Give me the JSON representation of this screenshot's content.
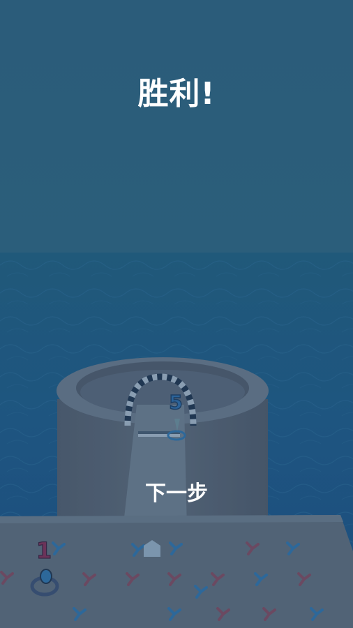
{
  "screen": {
    "title": "胜利!",
    "next_button_label": "下一步"
  },
  "scene": {
    "finish_gate_number": "5",
    "level_board_number": "1"
  },
  "colors": {
    "sky": "#2c6180",
    "sea": "#1d5888",
    "tower": "#57657a",
    "board": "#5b6a7c",
    "blue_figure": "#2f6fa8",
    "red_figure": "#7a4a62",
    "gate_dark": "#1f3450",
    "gate_light": "#9fb0c4",
    "level_number": "#7a2f58"
  },
  "icons": [
    "finish-gate-icon",
    "ring-icon",
    "stick-figure-icon",
    "checker-strip-icon"
  ]
}
